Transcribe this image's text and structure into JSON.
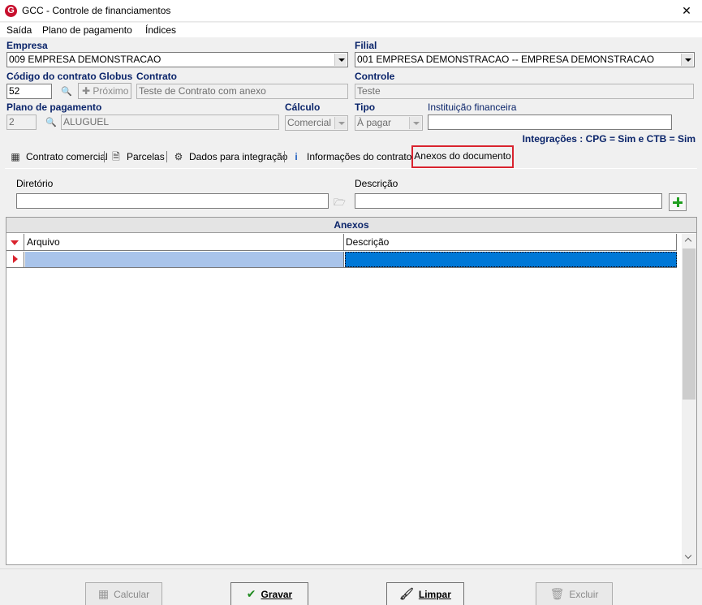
{
  "window": {
    "title": "GCC - Controle de financiamentos",
    "logo_letter": "G",
    "close_glyph": "✕"
  },
  "menu": {
    "items": [
      "Saída",
      "Plano de pagamento",
      "Índices"
    ]
  },
  "form": {
    "empresa": {
      "label": "Empresa",
      "value": "009 EMPRESA DEMONSTRACAO"
    },
    "filial": {
      "label": "Filial",
      "value": "001 EMPRESA DEMONSTRACAO -- EMPRESA DEMONSTRACAO"
    },
    "codigo": {
      "label": "Código do contrato Globus",
      "value": "52"
    },
    "proximo_label": "Próximo",
    "contrato": {
      "label": "Contrato",
      "value": "Teste de Contrato com anexo"
    },
    "controle": {
      "label": "Controle",
      "value": "Teste"
    },
    "plano": {
      "label": "Plano de pagamento",
      "code": "2",
      "value": "ALUGUEL"
    },
    "calculo": {
      "label": "Cálculo",
      "value": "Comercial"
    },
    "tipo": {
      "label": "Tipo",
      "value": "À pagar"
    },
    "instituicao": {
      "label": "Instituição financeira",
      "value": ""
    },
    "integracoes": "Integrações : CPG = Sim e CTB = Sim"
  },
  "tabs": [
    {
      "label": "Contrato comercial",
      "icon": "calculator-icon"
    },
    {
      "label": "Parcelas",
      "icon": "document-icon"
    },
    {
      "label": "Dados para integração",
      "icon": "gear-icon"
    },
    {
      "label": "Informações do contrato",
      "icon": "info-icon"
    }
  ],
  "active_tab": {
    "label": "Anexos do documento"
  },
  "anexos": {
    "diretorio_label": "Diretório",
    "diretorio_value": "",
    "descricao_label": "Descrição",
    "descricao_value": "",
    "grid_title": "Anexos",
    "columns": [
      "Arquivo",
      "Descrição"
    ],
    "rows": [
      {
        "arquivo": "",
        "descricao": ""
      }
    ]
  },
  "buttons": {
    "calcular": {
      "label": "Calcular",
      "enabled": false
    },
    "gravar": {
      "label": "Gravar",
      "enabled": true
    },
    "limpar": {
      "label": "Limpar",
      "enabled": true
    },
    "excluir": {
      "label": "Excluir",
      "enabled": false
    }
  },
  "colors": {
    "label_blue": "#0a246a",
    "highlight_red": "#d9232e",
    "row_selected_a": "#a9c4ea",
    "row_selected_b": "#0078d7",
    "add_green": "#1f9e1f"
  }
}
